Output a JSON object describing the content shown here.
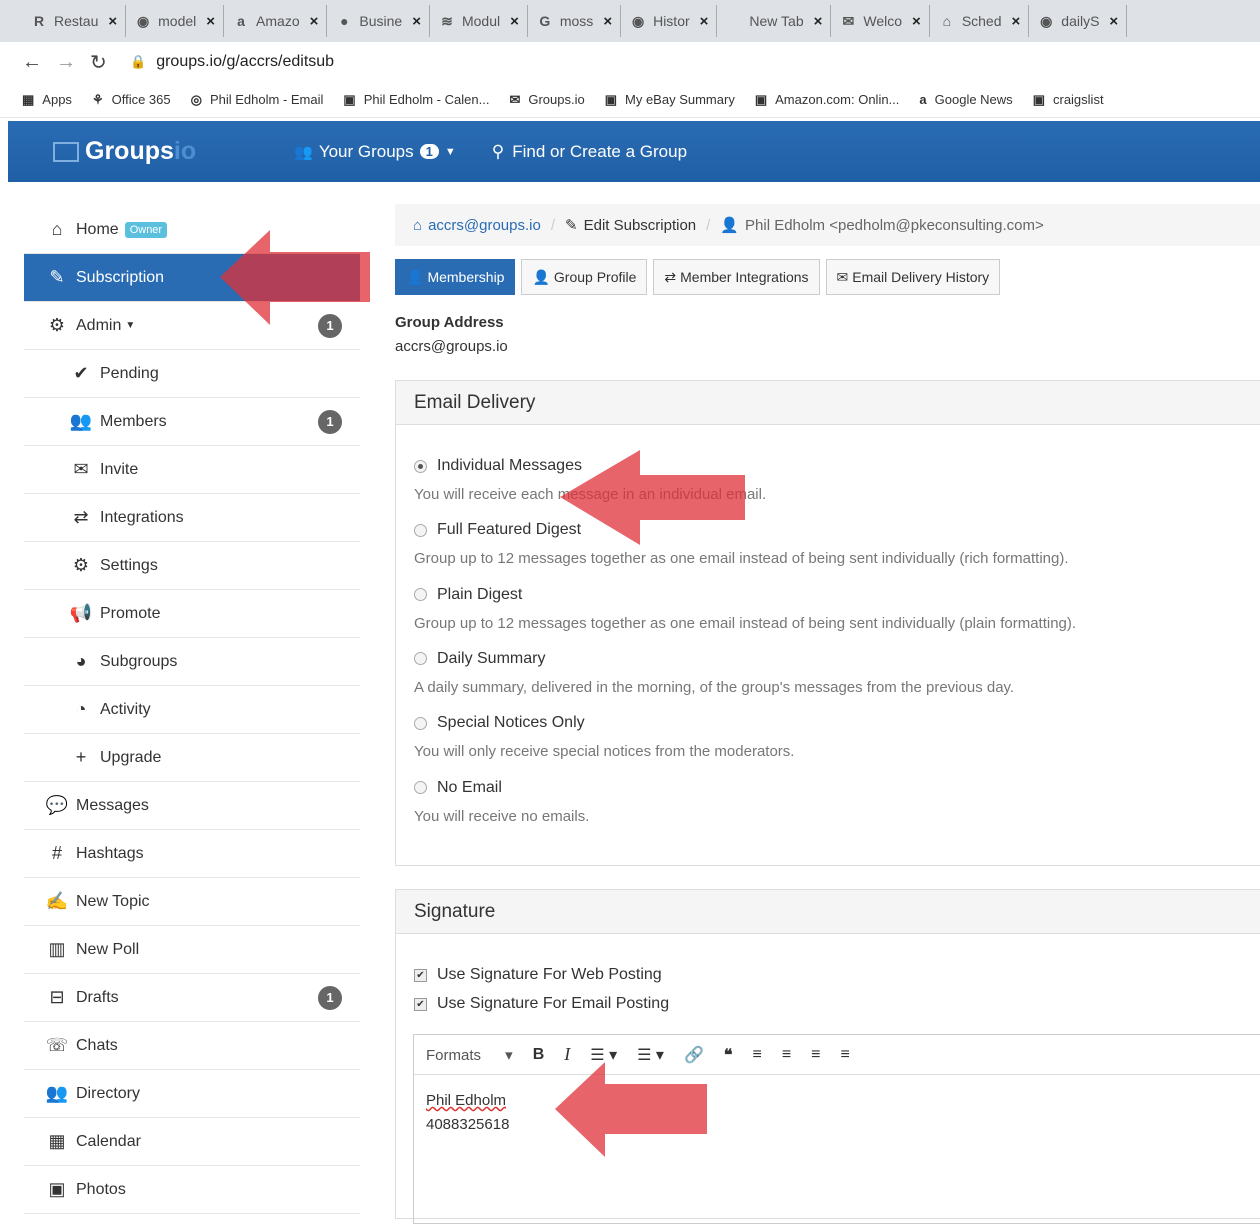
{
  "browser": {
    "tabs": [
      {
        "icon": "R",
        "label": "Restau"
      },
      {
        "icon": "◉",
        "label": "model"
      },
      {
        "icon": "a",
        "label": "Amazo"
      },
      {
        "icon": "●",
        "label": "Busine"
      },
      {
        "icon": "≋",
        "label": "Modul"
      },
      {
        "icon": "G",
        "label": "moss"
      },
      {
        "icon": "◉",
        "label": "Histor"
      },
      {
        "icon": "",
        "label": "New Tab"
      },
      {
        "icon": "✉",
        "label": "Welco"
      },
      {
        "icon": "⌂",
        "label": "Sched"
      },
      {
        "icon": "◉",
        "label": "dailyS"
      }
    ],
    "url": "groups.io/g/accrs/editsub",
    "bookmarks": [
      "Apps",
      "Office 365",
      "Phil Edholm - Email",
      "Phil Edholm - Calen...",
      "Groups.io",
      "My eBay Summary",
      "Amazon.com: Onlin...",
      "Google News",
      "craigslist"
    ]
  },
  "navbar": {
    "logo": "Groups",
    "logo_suffix": "io",
    "your_groups": "Your Groups",
    "your_groups_count": "1",
    "find_group": "Find or Create a Group"
  },
  "sidebar": {
    "home": "Home",
    "owner_badge": "Owner",
    "subscription": "Subscription",
    "admin": "Admin",
    "admin_count": "1",
    "pending": "Pending",
    "members": "Members",
    "members_count": "1",
    "invite": "Invite",
    "integrations": "Integrations",
    "settings": "Settings",
    "promote": "Promote",
    "subgroups": "Subgroups",
    "activity": "Activity",
    "upgrade": "Upgrade",
    "messages": "Messages",
    "hashtags": "Hashtags",
    "new_topic": "New Topic",
    "new_poll": "New Poll",
    "drafts": "Drafts",
    "drafts_count": "1",
    "chats": "Chats",
    "directory": "Directory",
    "calendar": "Calendar",
    "photos": "Photos"
  },
  "breadcrumb": {
    "group": "accrs@groups.io",
    "page": "Edit Subscription",
    "user": "Phil Edholm <pedholm@pkeconsulting.com>"
  },
  "tabs": {
    "membership": "Membership",
    "group_profile": "Group Profile",
    "member_integrations": "Member Integrations",
    "email_history": "Email Delivery History"
  },
  "group_address": {
    "label": "Group Address",
    "value": "accrs@groups.io"
  },
  "email_delivery": {
    "title": "Email Delivery",
    "options": [
      {
        "label": "Individual Messages",
        "desc": "You will receive each message in an individual email.",
        "selected": true
      },
      {
        "label": "Full Featured Digest",
        "desc": "Group up to 12 messages together as one email instead of being sent individually (rich formatting).",
        "selected": false
      },
      {
        "label": "Plain Digest",
        "desc": "Group up to 12 messages together as one email instead of being sent individually (plain formatting).",
        "selected": false
      },
      {
        "label": "Daily Summary",
        "desc": "A daily summary, delivered in the morning, of the group's messages from the previous day.",
        "selected": false
      },
      {
        "label": "Special Notices Only",
        "desc": "You will only receive special notices from the moderators.",
        "selected": false
      },
      {
        "label": "No Email",
        "desc": "You will receive no emails.",
        "selected": false
      }
    ]
  },
  "signature": {
    "title": "Signature",
    "web_label": "Use Signature For Web Posting",
    "web_checked": true,
    "email_label": "Use Signature For Email Posting",
    "email_checked": true,
    "formats_label": "Formats",
    "line1": "Phil Edholm",
    "line2": "4088325618"
  },
  "colors": {
    "primary": "#2a6cb4",
    "annotation_arrow": "#e0303a"
  }
}
